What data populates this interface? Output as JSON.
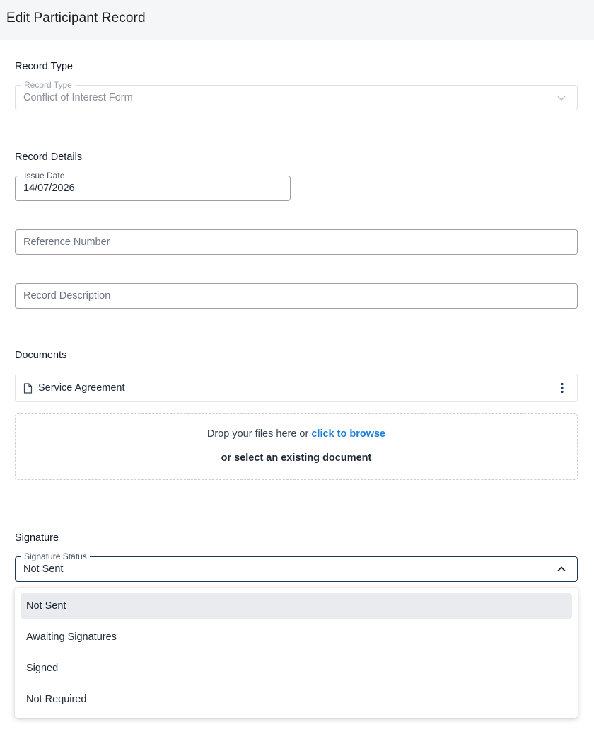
{
  "header": {
    "title": "Edit Participant Record"
  },
  "record_type": {
    "section_label": "Record Type",
    "legend": "Record Type",
    "value": "Conflict of Interest Form"
  },
  "record_details": {
    "section_label": "Record Details",
    "issue_date": {
      "legend": "Issue Date",
      "value": "14/07/2026"
    },
    "reference_number": {
      "placeholder": "Reference Number"
    },
    "record_description": {
      "placeholder": "Record Description"
    }
  },
  "documents": {
    "section_label": "Documents",
    "items": [
      {
        "name": "Service Agreement"
      }
    ],
    "dropzone": {
      "prefix": "Drop your files here or ",
      "browse_link": "click to browse",
      "select_existing": "or select an existing document"
    }
  },
  "signature": {
    "section_label": "Signature",
    "legend": "Signature Status",
    "value": "Not Sent",
    "options": [
      "Not Sent",
      "Awaiting Signatures",
      "Signed",
      "Not Required"
    ],
    "selected_option": "Not Sent"
  }
}
